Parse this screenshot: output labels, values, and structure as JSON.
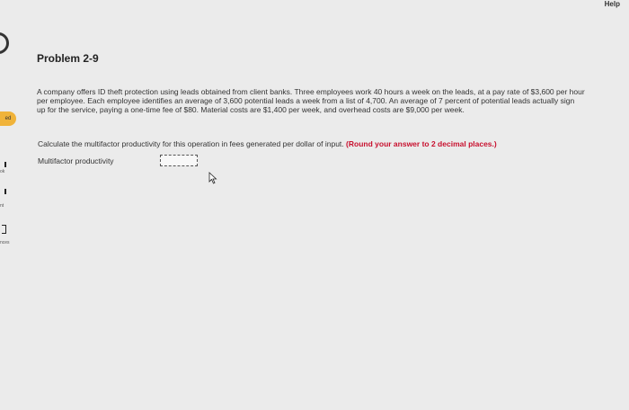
{
  "header": {
    "help_label": "Help"
  },
  "sidebar": {
    "status_badge": "ed",
    "fragments": [
      "ok",
      "nt",
      "nces"
    ]
  },
  "problem": {
    "title": "Problem 2-9",
    "text": "A company offers ID theft protection using leads obtained from client banks. Three employees work 40 hours a week on the leads, at a pay rate of $3,600 per hour per employee. Each employee identifies an average of 3,600 potential leads a week from a list of 4,700. An average of 7 percent of potential leads actually sign up for the service, paying a one-time fee of $80. Material costs are $1,400 per week, and overhead costs are $9,000 per week.",
    "instruction": "Calculate the multifactor productivity for this operation in fees generated per dollar of input.",
    "instruction_note": "(Round your answer to 2 decimal places.)"
  },
  "answer": {
    "label": "Multifactor productivity",
    "value": ""
  },
  "icons": {
    "cursor": "mouse-pointer-icon",
    "side_arc": "circle-arc-icon"
  }
}
